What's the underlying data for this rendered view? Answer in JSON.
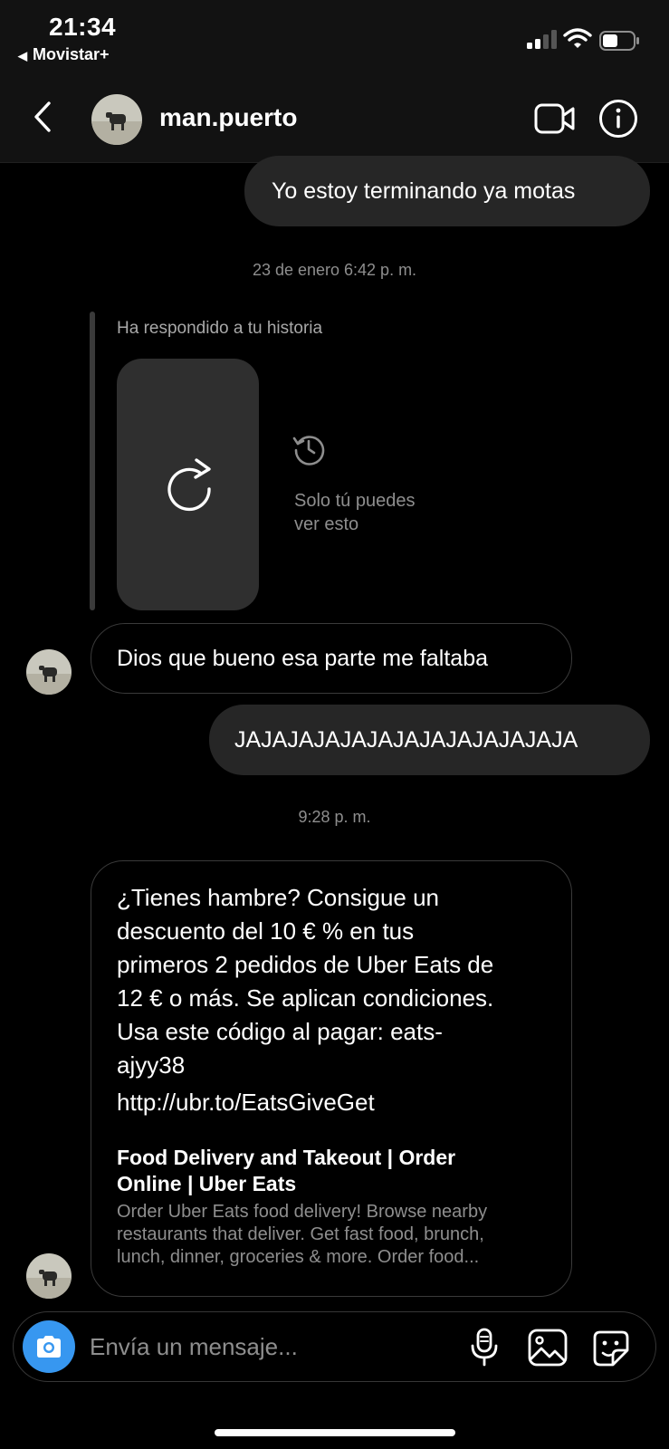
{
  "status_bar": {
    "time": "21:34",
    "carrier": "Movistar+",
    "back_to_app_glyph": "◀"
  },
  "header": {
    "username": "man.puerto",
    "back_icon": "chevron-left-icon",
    "video_icon": "video-camera-icon",
    "info_icon": "info-icon"
  },
  "messages": {
    "outgoing_1": "Yo estoy terminando ya motas",
    "timestamp_1": "23 de enero 6:42 p. m.",
    "story_reply_label": "Ha respondido a tu historia",
    "story_notice": "Solo tú puedes\nver esto",
    "incoming_1": "Dios que bueno esa parte me faltaba",
    "outgoing_2": "JAJAJAJAJAJAJAJAJAJAJAJAJA",
    "timestamp_2": "9:28 p. m.",
    "promo": {
      "text": "¿Tienes hambre? Consigue un\ndescuento del 10 € % en tus\nprimeros 2 pedidos de Uber Eats de\n12 € o más. Se aplican condiciones.\nUsa este código al pagar: eats-\najyy38",
      "link": "http://ubr.to/EatsGiveGet",
      "preview_title": "Food Delivery and Takeout | Order\nOnline | Uber Eats",
      "preview_description": "Order Uber Eats food delivery! Browse nearby\nrestaurants that deliver. Get fast food, brunch,\nlunch, dinner, groceries & more. Order food..."
    }
  },
  "composer": {
    "placeholder": "Envía un mensaje...",
    "value": ""
  },
  "colors": {
    "background": "#000000",
    "header": "#121212",
    "outgoing_bubble": "#262626",
    "incoming_border": "#3a3a3a",
    "secondary_text": "#8e8e8e",
    "camera_accent": "#3797f0"
  }
}
